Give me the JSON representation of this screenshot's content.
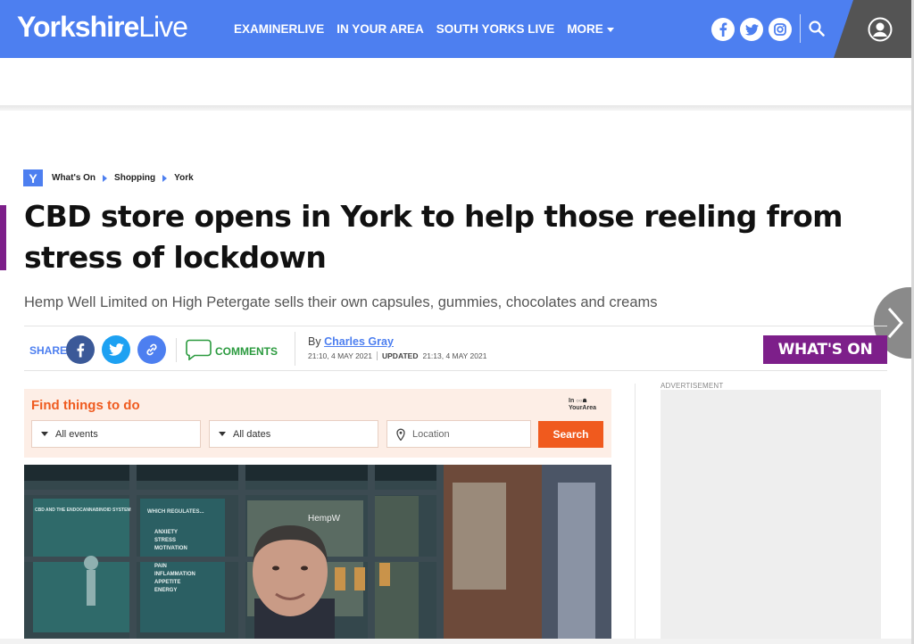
{
  "header": {
    "logo_bold": "Yorkshire",
    "logo_light": "Live",
    "nav": [
      "EXAMINERLIVE",
      "IN YOUR AREA",
      "SOUTH YORKS LIVE",
      "MORE"
    ],
    "social_icons": [
      "facebook-icon",
      "twitter-icon",
      "instagram-icon"
    ],
    "brand_color": "#4d7ff0"
  },
  "breadcrumb": {
    "badge": "Y",
    "items": [
      "What's On",
      "Shopping",
      "York"
    ]
  },
  "article": {
    "headline": "CBD store opens in York to help those reeling from stress of lockdown",
    "standfirst": "Hemp Well Limited on High Petergate sells their own capsules, gummies, chocolates and creams",
    "accent_color": "#7d1f8a"
  },
  "share_bar": {
    "share_label": "SHARE",
    "comments_label": "COMMENTS",
    "by_prefix": "By",
    "author": "Charles Gray",
    "published": "21:10, 4 MAY 2021",
    "updated_label": "UPDATED",
    "updated": "21:13, 4 MAY 2021",
    "section_badge": "WHAT'S ON"
  },
  "widget": {
    "title": "Find things to do",
    "brand_line1": "In",
    "brand_line2": "YourArea",
    "events_select": "All events",
    "dates_select": "All dates",
    "location_placeholder": "Location",
    "search_button": "Search"
  },
  "hero": {
    "poster_left_title": "CBD AND THE ENDOCANNABINOID SYSTEM",
    "poster_mid_title": "WHICH REGULATES...",
    "poster_mid_items": [
      "ANXIETY",
      "STRESS",
      "MOTIVATION"
    ],
    "poster_mid_items2": [
      "PAIN",
      "INFLAMMATION",
      "APPETITE",
      "ENERGY"
    ],
    "shop_sign": "HempW"
  },
  "sidebar": {
    "ad_label": "ADVERTISEMENT"
  }
}
